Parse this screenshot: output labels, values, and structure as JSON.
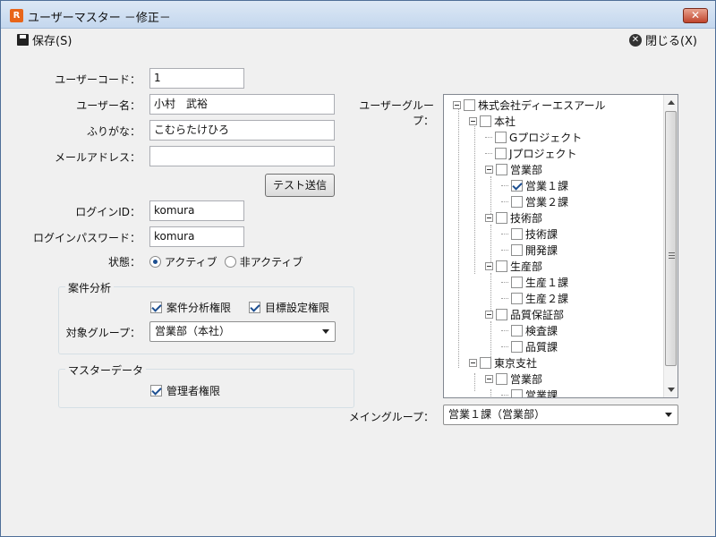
{
  "window": {
    "title": "ユーザーマスター －修正－",
    "app_icon": "app-logo-icon",
    "close_glyph": "✕"
  },
  "toolbar": {
    "save_label": "保存(S)",
    "close_label": "閉じる(X)"
  },
  "form": {
    "user_code": {
      "label": "ユーザーコード：",
      "value": "1"
    },
    "user_name": {
      "label": "ユーザー名：",
      "value": "小村　武裕"
    },
    "furigana": {
      "label": "ふりがな：",
      "value": "こむらたけひろ"
    },
    "email": {
      "label": "メールアドレス：",
      "value": ""
    },
    "test_send_label": "テスト送信",
    "login_id": {
      "label": "ログインID：",
      "value": "komura"
    },
    "login_password": {
      "label": "ログインパスワード：",
      "value": "komura"
    },
    "status": {
      "label": "状態：",
      "options": [
        "アクティブ",
        "非アクティブ"
      ],
      "selected": "アクティブ"
    }
  },
  "case_analysis": {
    "title": "案件分析",
    "perm_label": "案件分析権限",
    "perm_checked": true,
    "goal_label": "目標設定権限",
    "goal_checked": true,
    "target_group_label": "対象グループ：",
    "target_group_value": "営業部（本社）"
  },
  "master_data": {
    "title": "マスターデータ",
    "admin_label": "管理者権限",
    "admin_checked": true
  },
  "user_group": {
    "label": "ユーザーグループ：",
    "nodes": [
      {
        "label": "株式会社ディーエスアール",
        "checked": false
      },
      {
        "label": "本社",
        "checked": false
      },
      {
        "label": "Gプロジェクト",
        "checked": false
      },
      {
        "label": "Jプロジェクト",
        "checked": false
      },
      {
        "label": "営業部",
        "checked": false
      },
      {
        "label": "営業１課",
        "checked": true
      },
      {
        "label": "営業２課",
        "checked": false
      },
      {
        "label": "技術部",
        "checked": false
      },
      {
        "label": "技術課",
        "checked": false
      },
      {
        "label": "開発課",
        "checked": false
      },
      {
        "label": "生産部",
        "checked": false
      },
      {
        "label": "生産１課",
        "checked": false
      },
      {
        "label": "生産２課",
        "checked": false
      },
      {
        "label": "品質保証部",
        "checked": false
      },
      {
        "label": "検査課",
        "checked": false
      },
      {
        "label": "品質課",
        "checked": false
      },
      {
        "label": "東京支社",
        "checked": false
      },
      {
        "label": "営業部",
        "checked": false
      },
      {
        "label": "営業課",
        "checked": false
      }
    ]
  },
  "main_group": {
    "label": "メイングループ：",
    "value": "営業１課（営業部）"
  }
}
